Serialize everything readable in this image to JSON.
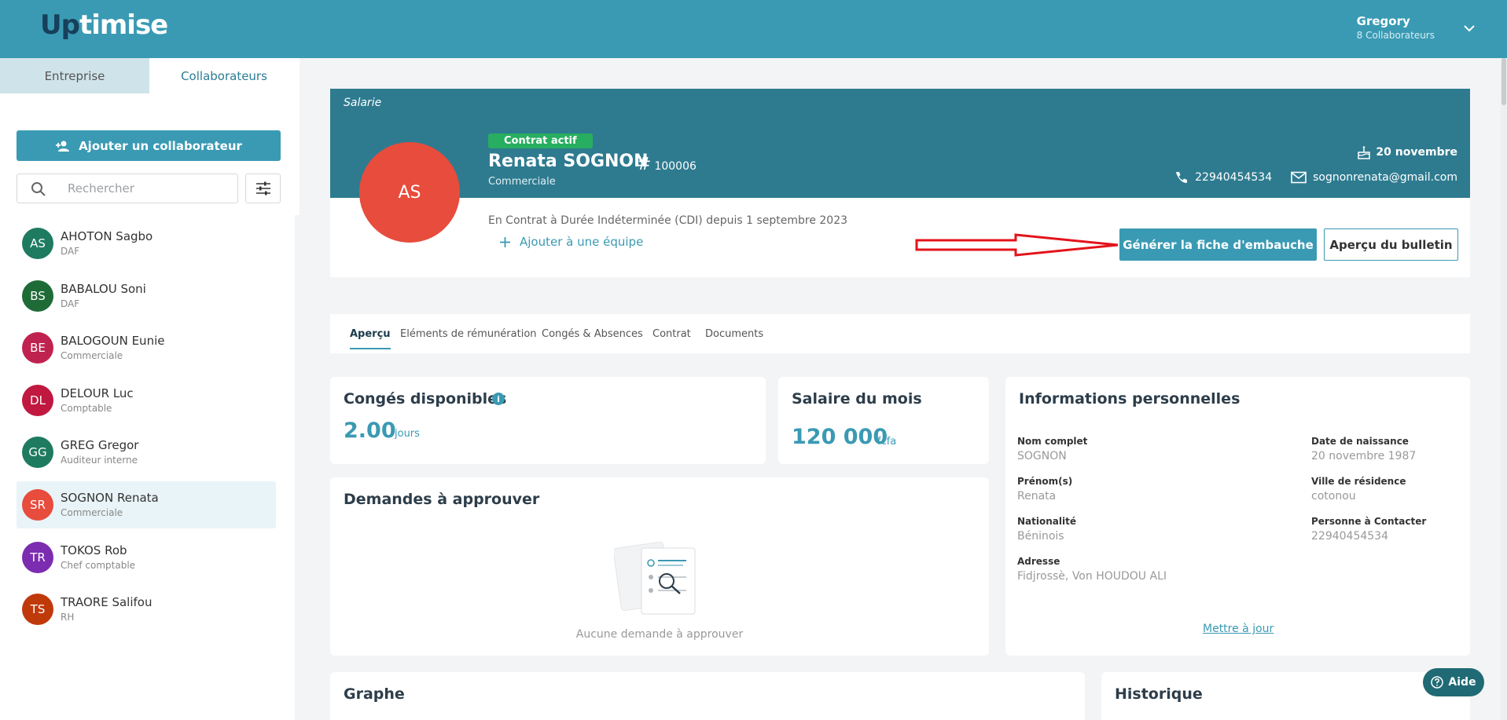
{
  "header": {
    "logo_up": "Up",
    "logo_rest": "timise",
    "user_name": "Gregory",
    "user_sub": "8 Collaborateurs"
  },
  "sidebar": {
    "tabs": [
      "Entreprise",
      "Collaborateurs"
    ],
    "add_button": "Ajouter un collaborateur",
    "search_placeholder": "Rechercher",
    "employees": [
      {
        "initials": "AS",
        "name": "AHOTON Sagbo",
        "role": "DAF",
        "color": "#1e7b5f"
      },
      {
        "initials": "BS",
        "name": "BABALOU Soni",
        "role": "DAF",
        "color": "#1e6b38"
      },
      {
        "initials": "BE",
        "name": "BALOGOUN Eunie",
        "role": "Commerciale",
        "color": "#c0224f"
      },
      {
        "initials": "DL",
        "name": "DELOUR Luc",
        "role": "Comptable",
        "color": "#c0183f"
      },
      {
        "initials": "GG",
        "name": "GREG Gregor",
        "role": "Auditeur interne",
        "color": "#1e7b5f"
      },
      {
        "initials": "SR",
        "name": "SOGNON Renata",
        "role": "Commerciale",
        "color": "#e74c3c"
      },
      {
        "initials": "TR",
        "name": "TOKOS Rob",
        "role": "Chef comptable",
        "color": "#7b2cb0"
      },
      {
        "initials": "TS",
        "name": "TRAORE Salifou",
        "role": "RH",
        "color": "#c0390b"
      }
    ]
  },
  "profile": {
    "section": "Salarie",
    "initials": "AS",
    "badge": "Contrat actif",
    "name": "Renata SOGNON",
    "hash_symbol": "#",
    "id": "100006",
    "role": "Commerciale",
    "birthday": "20 novembre",
    "phone": "22940454534",
    "email": "sognonrenata@gmail.com",
    "contract": "En Contrat à Durée Indéterminée (CDI) depuis 1 septembre 2023",
    "add_team": "Ajouter à une équipe",
    "generate_button": "Générer la fiche d'embauche",
    "preview_button": "Aperçu du bulletin"
  },
  "tabs": [
    "Aperçu",
    "Eléments de rémunération",
    "Congés & Absences",
    "Contrat",
    "Documents"
  ],
  "conges": {
    "title": "Congés disponibles",
    "value": "2.00",
    "unit": "jours"
  },
  "salaire": {
    "title": "Salaire du mois",
    "value": "120 000",
    "unit": "fcfa"
  },
  "demandes": {
    "title": "Demandes à approuver",
    "empty": "Aucune demande à approuver"
  },
  "infos": {
    "title": "Informations personnelles",
    "fields": {
      "nom_label": "Nom complet",
      "nom": "SOGNON",
      "prenom_label": "Prénom(s)",
      "prenom": "Renata",
      "nat_label": "Nationalité",
      "nat": "Béninois",
      "adr_label": "Adresse",
      "adr": "Fidjrossè, Von HOUDOU ALI",
      "dob_label": "Date de naissance",
      "dob": "20 novembre 1987",
      "ville_label": "Ville de résidence",
      "ville": "cotonou",
      "contact_label": "Personne à Contacter",
      "contact": "22940454534"
    },
    "update_link": "Mettre à jour"
  },
  "graphe": {
    "title": "Graphe"
  },
  "historique": {
    "title": "Historique"
  },
  "help": {
    "label": "Aide"
  },
  "colors": {
    "primary": "#3a9ab3",
    "header_band": "#2e7b90",
    "badge": "#27ae60",
    "avatar": "#e74c3c",
    "arrow": "#e3131b"
  }
}
